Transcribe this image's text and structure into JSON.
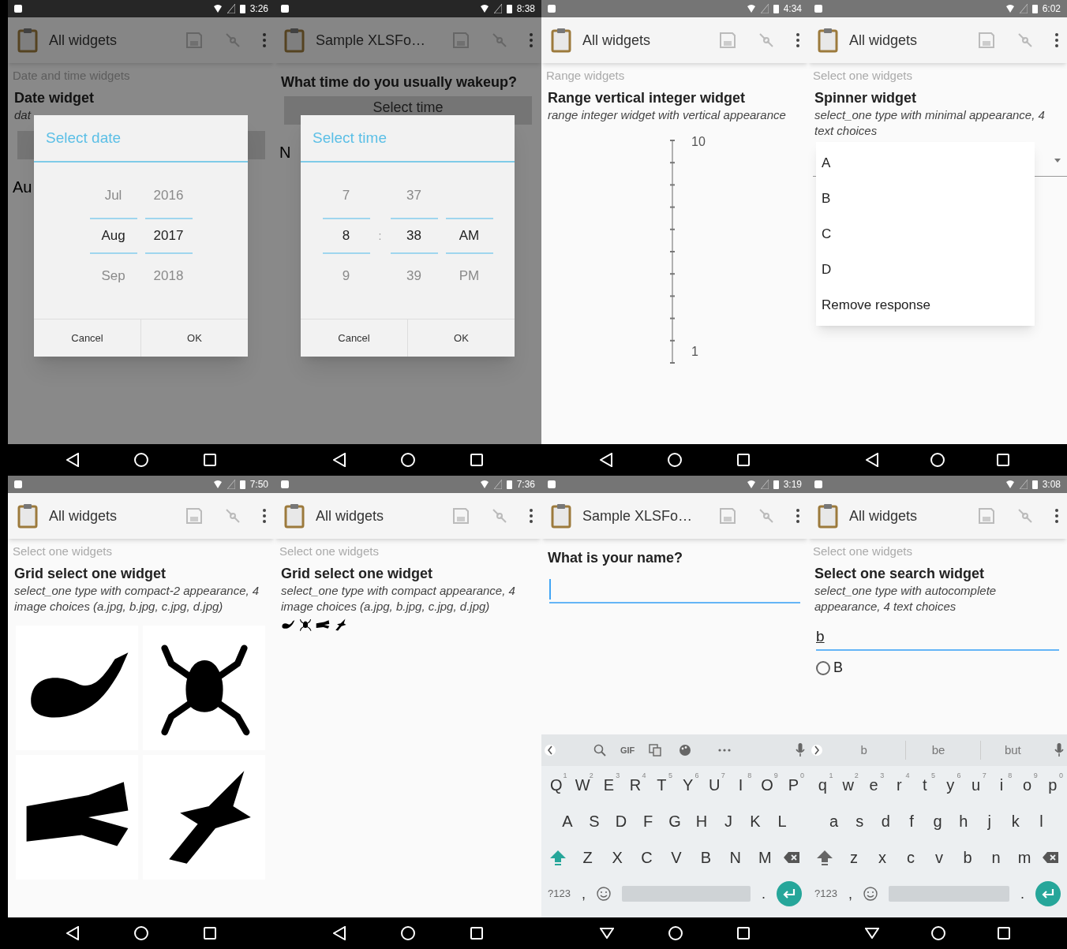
{
  "panels": [
    {
      "kind": "date",
      "dimmed": true,
      "status_bar": {
        "time": "3:26"
      },
      "app_bar": {
        "title": "All widgets"
      },
      "group": "Date and time widgets",
      "heading": "Date widget",
      "hint": "dat",
      "answer": "Au",
      "dialog": {
        "title": "Select date",
        "columns": [
          [
            {
              "text": "Jul",
              "selected": false
            },
            {
              "text": "Aug",
              "selected": true
            },
            {
              "text": "Sep",
              "selected": false
            }
          ],
          [
            {
              "text": "2016",
              "selected": false
            },
            {
              "text": "2017",
              "selected": true
            },
            {
              "text": "2018",
              "selected": false
            }
          ]
        ],
        "buttons": [
          "Cancel",
          "OK"
        ]
      }
    },
    {
      "kind": "time",
      "dimmed": true,
      "status_bar": {
        "time": "8:38"
      },
      "app_bar": {
        "title": "Sample XLSFo…"
      },
      "heading": "What time do you usually wakeup?",
      "button": "Select time",
      "answer": "N",
      "dialog": {
        "title": "Select time",
        "separator": ":",
        "columns": [
          [
            {
              "text": "7",
              "selected": false
            },
            {
              "text": "8",
              "selected": true
            },
            {
              "text": "9",
              "selected": false
            }
          ],
          [
            {
              "text": "37",
              "selected": false
            },
            {
              "text": "38",
              "selected": true
            },
            {
              "text": "39",
              "selected": false
            }
          ],
          [
            {
              "text": "AM",
              "selected": true
            },
            {
              "text": "PM",
              "selected": false
            }
          ]
        ],
        "buttons": [
          "Cancel",
          "OK"
        ]
      }
    },
    {
      "kind": "range",
      "dimmed": false,
      "status_bar": {
        "time": "4:34"
      },
      "app_bar": {
        "title": "All widgets"
      },
      "group": "Range widgets",
      "heading": "Range vertical integer widget",
      "hint": "range integer widget with vertical appearance",
      "range": {
        "max_label": "10",
        "min_label": "1"
      }
    },
    {
      "kind": "spinner",
      "dimmed": false,
      "status_bar": {
        "time": "6:02"
      },
      "app_bar": {
        "title": "All widgets"
      },
      "group": "Select one widgets",
      "heading": "Spinner widget",
      "hint": "select_one type with minimal appearance, 4 text choices",
      "menu": [
        "A",
        "B",
        "C",
        "D",
        "Remove response"
      ]
    },
    {
      "kind": "image_grid_large",
      "dimmed": false,
      "status_bar": {
        "time": "7:50"
      },
      "app_bar": {
        "title": "All widgets"
      },
      "group": "Select one widgets",
      "heading": "Grid select one widget",
      "hint": "select_one type with compact-2 appearance, 4 image choices (a.jpg, b.jpg, c.jpg, d.jpg)"
    },
    {
      "kind": "image_grid_small",
      "dimmed": false,
      "status_bar": {
        "time": "7:36"
      },
      "app_bar": {
        "title": "All widgets"
      },
      "group": "Select one widgets",
      "heading": "Grid select one widget",
      "hint": "select_one type with compact appearance, 4 image choices (a.jpg, b.jpg, c.jpg, d.jpg)"
    },
    {
      "kind": "text",
      "dimmed": false,
      "status_bar": {
        "time": "3:19"
      },
      "app_bar": {
        "title": "Sample XLSFo…"
      },
      "heading": "What is your name?",
      "keyboard": {
        "toolbar": {
          "kind": "tools",
          "gif": "GIF"
        },
        "shifted": true,
        "hints": [
          "1",
          "2",
          "3",
          "4",
          "5",
          "6",
          "7",
          "8",
          "9",
          "0"
        ],
        "rows": [
          [
            "Q",
            "W",
            "E",
            "R",
            "T",
            "Y",
            "U",
            "I",
            "O",
            "P"
          ],
          [
            "A",
            "S",
            "D",
            "F",
            "G",
            "H",
            "J",
            "K",
            "L"
          ],
          [
            "Z",
            "X",
            "C",
            "V",
            "B",
            "N",
            "M"
          ]
        ],
        "symbols": "?123",
        "comma": ",",
        "period": "."
      }
    },
    {
      "kind": "search",
      "dimmed": false,
      "status_bar": {
        "time": "3:08"
      },
      "app_bar": {
        "title": "All widgets"
      },
      "group": "Select one widgets",
      "heading": "Select one search widget",
      "hint": "select_one type with autocomplete appearance, 4 text choices",
      "value": "b",
      "options": [
        {
          "label": "B",
          "selected": false
        }
      ],
      "keyboard": {
        "toolbar": {
          "kind": "suggestions",
          "items": [
            "b",
            "be",
            "but"
          ]
        },
        "shifted": false,
        "hints": [
          "1",
          "2",
          "3",
          "4",
          "5",
          "6",
          "7",
          "8",
          "9",
          "0"
        ],
        "rows": [
          [
            "q",
            "w",
            "e",
            "r",
            "t",
            "y",
            "u",
            "i",
            "o",
            "p"
          ],
          [
            "a",
            "s",
            "d",
            "f",
            "g",
            "h",
            "j",
            "k",
            "l"
          ],
          [
            "z",
            "x",
            "c",
            "v",
            "b",
            "n",
            "m"
          ]
        ],
        "symbols": "?123",
        "comma": ",",
        "period": "."
      }
    }
  ]
}
